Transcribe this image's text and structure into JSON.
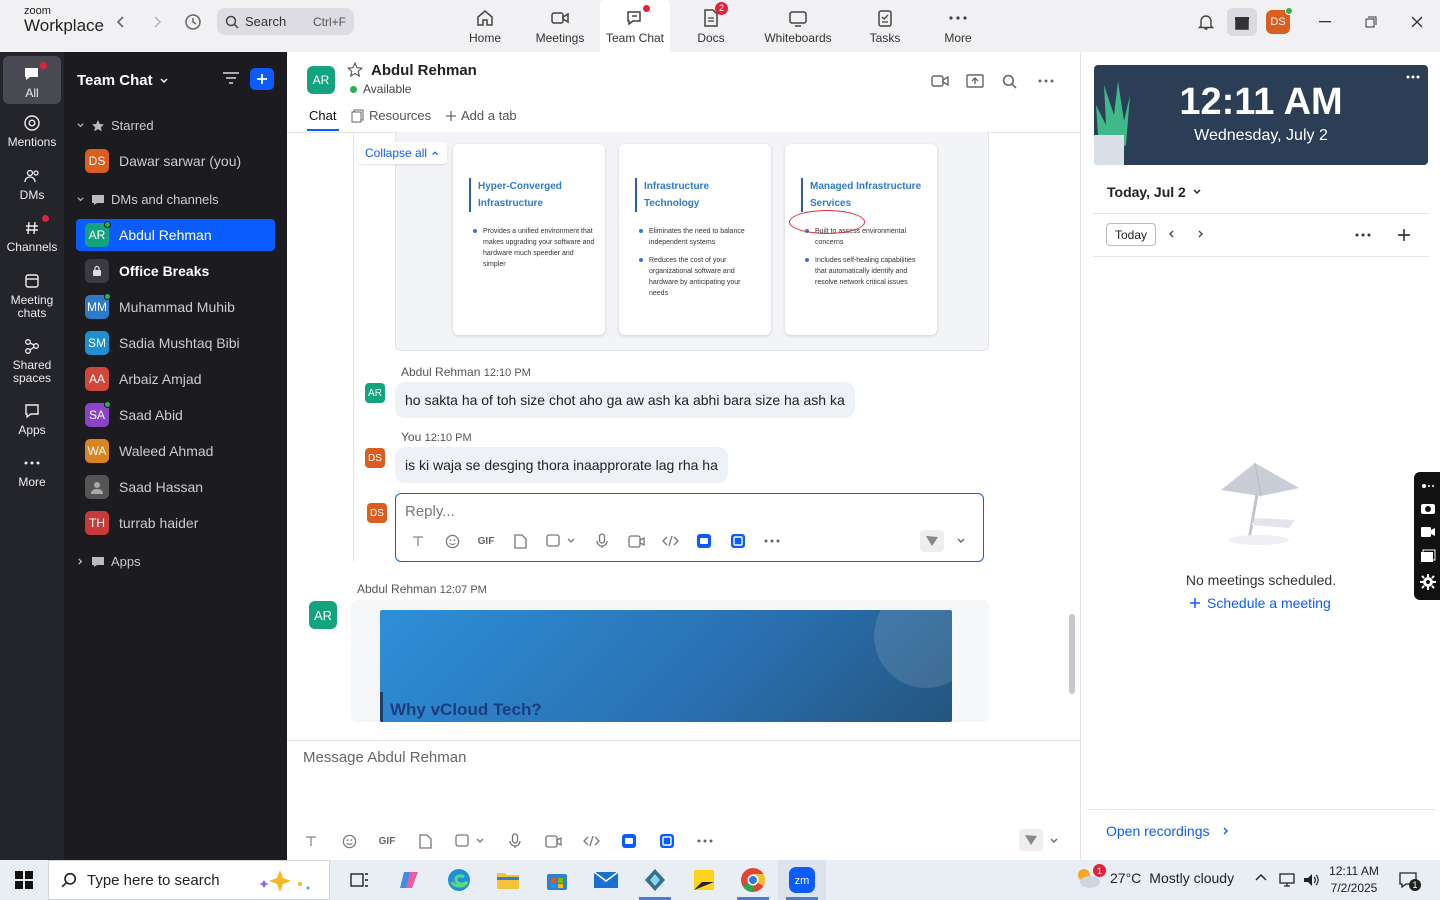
{
  "app": {
    "logo_top": "zoom",
    "logo_bottom": "Workplace"
  },
  "search": {
    "placeholder": "Search",
    "shortcut": "Ctrl+F"
  },
  "nav_tabs": [
    {
      "label": "Home",
      "icon": "home-icon"
    },
    {
      "label": "Meetings",
      "icon": "video-icon"
    },
    {
      "label": "Team Chat",
      "icon": "chat-icon",
      "active": true
    },
    {
      "label": "Docs",
      "icon": "doc-icon",
      "badge": "2"
    },
    {
      "label": "Whiteboards",
      "icon": "whiteboard-icon"
    },
    {
      "label": "Tasks",
      "icon": "tasks-icon"
    },
    {
      "label": "More",
      "icon": "more-icon"
    }
  ],
  "profile": {
    "initials": "DS"
  },
  "rail": [
    {
      "label": "All"
    },
    {
      "label": "Mentions"
    },
    {
      "label": "DMs"
    },
    {
      "label": "Channels"
    },
    {
      "label": "Meeting chats"
    },
    {
      "label": "Shared spaces"
    },
    {
      "label": "Apps"
    },
    {
      "label": "More"
    }
  ],
  "sidebar": {
    "title": "Team Chat",
    "starred_label": "Starred",
    "dms_label": "DMs and channels",
    "apps_label": "Apps",
    "starred": [
      {
        "initials": "DS",
        "name": "Dawar sarwar (you)",
        "color": "#d95e1f"
      }
    ],
    "items": [
      {
        "initials": "AR",
        "name": "Abdul Rehman",
        "color": "#14a37f"
      },
      {
        "initials": "",
        "name": "Office Breaks",
        "color": "#3a3a42"
      },
      {
        "initials": "MM",
        "name": "Muhammad Muhib",
        "color": "#2f79c9"
      },
      {
        "initials": "SM",
        "name": "Sadia Mushtaq Bibi",
        "color": "#1f8fd1"
      },
      {
        "initials": "AA",
        "name": "Arbaiz Amjad",
        "color": "#d0463a"
      },
      {
        "initials": "SA",
        "name": "Saad Abid",
        "color": "#8a44c7"
      },
      {
        "initials": "WA",
        "name": "Waleed Ahmad",
        "color": "#d9841f"
      },
      {
        "initials": "",
        "name": "Saad Hassan",
        "color": "#555"
      },
      {
        "initials": "TH",
        "name": "turrab haider",
        "color": "#c73a3a"
      }
    ]
  },
  "chat": {
    "contact_initials": "AR",
    "contact_name": "Abdul Rehman",
    "status": "Available",
    "tab_chat": "Chat",
    "tab_resources": "Resources",
    "tab_add": "Add a tab",
    "collapse_all": "Collapse all",
    "cards": [
      {
        "title": "Hyper-Converged Infrastructure",
        "bullets": [
          "Provides a unified environment that makes upgrading your software and hardware much speedier and simpler"
        ]
      },
      {
        "title": "Infrastructure Technology",
        "bullets": [
          "Eliminates the need to balance independent systems",
          "Reduces the cost of your organizational software and hardware by anticipating your needs"
        ]
      },
      {
        "title": "Managed Infrastructure Services",
        "bullets": [
          "Built to assess environmental concerns",
          "Includes self-healing capabilities that automatically identify and resolve network critical issues"
        ]
      }
    ],
    "messages": [
      {
        "author": "Abdul Rehman",
        "time": "12:10 PM",
        "initials": "AR",
        "text": "ho sakta ha of toh size chot aho ga aw ash ka abhi bara size ha ash ka"
      },
      {
        "author": "You",
        "time": "12:10 PM",
        "initials": "DS",
        "text": "is ki waja se desging thora inaapprorate lag rha ha"
      }
    ],
    "reply_placeholder": "Reply...",
    "reply_initials": "DS",
    "older": {
      "author": "Abdul Rehman",
      "time": "12:07 PM",
      "initials": "AR",
      "slide_title": "Why vCloud Tech?"
    },
    "message_placeholder": "Message Abdul Rehman"
  },
  "right": {
    "time": "12:11 AM",
    "date": "Wednesday, July 2",
    "day_label": "Today, Jul 2",
    "today_btn": "Today",
    "empty": "No meetings scheduled.",
    "schedule": "Schedule a meeting",
    "recordings": "Open recordings"
  },
  "taskbar": {
    "search_placeholder": "Type here to search",
    "weather_temp": "27°C",
    "weather_text": "Mostly cloudy",
    "time": "12:11 AM",
    "date": "7/2/2025",
    "notif_count": "1",
    "weather_badge": "1"
  }
}
